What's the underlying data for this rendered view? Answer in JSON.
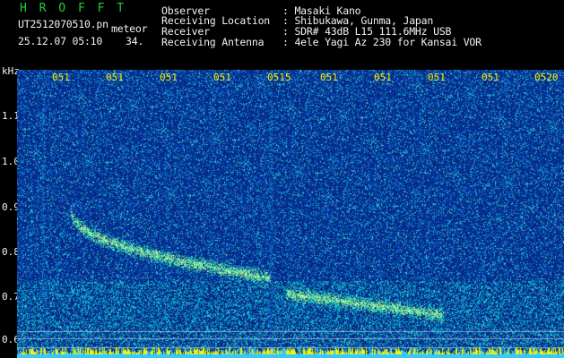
{
  "header": {
    "app_name": "H R O F F T",
    "file_name": "UT2512070510.pn",
    "file_suffix": "meteor",
    "date_time": "25.12.07 05:10",
    "frame_number": "34.",
    "labels": [
      "Observer",
      "Receiving Location",
      "Receiver",
      "Receiving Antenna"
    ],
    "values": [
      ": Masaki Kano",
      ": Shibukawa, Gunma, Japan",
      ": SDR# 43dB L15 111.6MHz USB",
      ": 4ele Yagi Az 230 for Kansai VOR"
    ]
  },
  "axis": {
    "unit": "kHz",
    "y_ticks": [
      "1.1",
      "1.0",
      "0.9",
      "0.8",
      "0.7",
      "0.6"
    ],
    "x_ticks": [
      "051",
      "051",
      "051",
      "051",
      "0515",
      "051",
      "051",
      "051",
      "051",
      "0520"
    ]
  },
  "colors": {
    "background": "#000000",
    "waterfall_base": "#0a2a8c",
    "echo_trace": "#c8f08c",
    "band_yellow": "#f6f300",
    "band_cyan": "#33c8ff"
  }
}
